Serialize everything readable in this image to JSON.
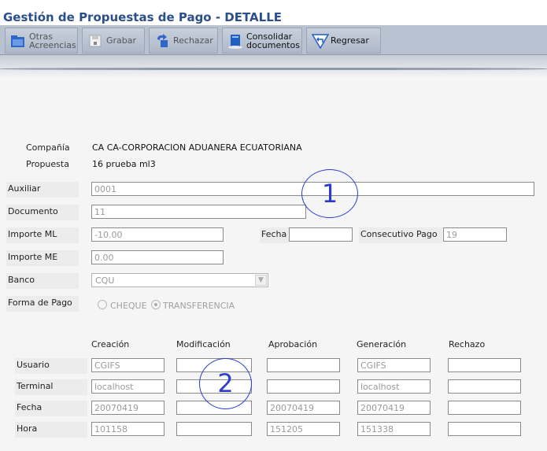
{
  "window": {
    "title": "Gestión de Propuestas de Pago - DETALLE"
  },
  "toolbar": {
    "otras_acreencias": "Otras\nAcreencias",
    "grabar": "Grabar",
    "rechazar": "Rechazar",
    "consolidar": "Consolidar\ndocumentos",
    "regresar": "Regresar"
  },
  "header": {
    "compania_label": "Compañía",
    "compania_value": "CA CA-CORPORACION ADUANERA ECUATORIANA",
    "propuesta_label": "Propuesta",
    "propuesta_value": "16 prueba ml3"
  },
  "form": {
    "auxiliar_label": "Auxiliar",
    "auxiliar_value": "0001",
    "documento_label": "Documento",
    "documento_value": "11",
    "importe_ml_label": "Importe ML",
    "importe_ml_value": "-10.00",
    "fecha_label": "Fecha",
    "fecha_value": "",
    "consecutivo_label": "Consecutivo Pago",
    "consecutivo_value": "19",
    "importe_me_label": "Importe ME",
    "importe_me_value": "0.00",
    "banco_label": "Banco",
    "banco_value": "CQU",
    "forma_pago_label": "Forma de Pago",
    "forma_pago_options": [
      "CHEQUE",
      "TRANSFERENCIA"
    ],
    "forma_pago_selected": "TRANSFERENCIA"
  },
  "audit": {
    "columns": [
      "Creación",
      "Modificación",
      "Aprobación",
      "Generación",
      "Rechazo"
    ],
    "rows": [
      {
        "label": "Usuario",
        "values": [
          "CGIFS",
          "",
          "",
          "CGIFS",
          ""
        ]
      },
      {
        "label": "Terminal",
        "values": [
          "localhost",
          "",
          "",
          "localhost",
          ""
        ]
      },
      {
        "label": "Fecha",
        "values": [
          "20070419",
          "",
          "20070419",
          "20070419",
          ""
        ]
      },
      {
        "label": "Hora",
        "values": [
          "101158",
          "",
          "151205",
          "151338",
          ""
        ]
      }
    ]
  },
  "annotations": {
    "one": "1",
    "two": "2"
  },
  "colors": {
    "title": "#2a4f8a",
    "toolbar": "#b8c2d0",
    "annotation": "#2b3ccf"
  }
}
